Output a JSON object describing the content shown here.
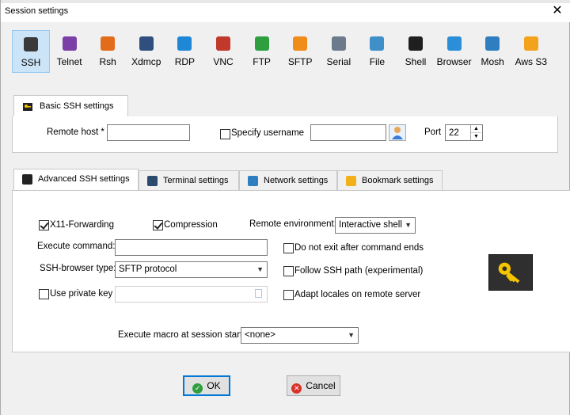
{
  "window": {
    "title": "Session settings",
    "close_glyph": "✕"
  },
  "session_types": [
    {
      "label": "SSH",
      "icon": "ssh-icon",
      "color": "#3a3a3a",
      "selected": true
    },
    {
      "label": "Telnet",
      "icon": "telnet-icon",
      "color": "#7b3fa8"
    },
    {
      "label": "Rsh",
      "icon": "rsh-icon",
      "color": "#e26c1a"
    },
    {
      "label": "Xdmcp",
      "icon": "xdmcp-icon",
      "color": "#2f4f7f"
    },
    {
      "label": "RDP",
      "icon": "rdp-icon",
      "color": "#1e88d6"
    },
    {
      "label": "VNC",
      "icon": "vnc-icon",
      "color": "#c0392b"
    },
    {
      "label": "FTP",
      "icon": "ftp-icon",
      "color": "#2e9e3e"
    },
    {
      "label": "SFTP",
      "icon": "sftp-icon",
      "color": "#f08c1a"
    },
    {
      "label": "Serial",
      "icon": "serial-icon",
      "color": "#6b7b8c"
    },
    {
      "label": "File",
      "icon": "file-icon",
      "color": "#3f8fc8"
    },
    {
      "label": "Shell",
      "icon": "shell-icon",
      "color": "#1f1f1f"
    },
    {
      "label": "Browser",
      "icon": "browser-icon",
      "color": "#2a8fd8"
    },
    {
      "label": "Mosh",
      "icon": "mosh-icon",
      "color": "#2f7fc0"
    },
    {
      "label": "Aws S3",
      "icon": "aws-s3-icon",
      "color": "#f2a31b"
    }
  ],
  "basic": {
    "tab_label": "Basic SSH settings",
    "remote_host_label": "Remote host *",
    "remote_host_value": "",
    "specify_username_label": "Specify username",
    "username_value": "",
    "port_label": "Port",
    "port_value": "22"
  },
  "tabs": [
    {
      "label": "Advanced SSH settings",
      "icon": "key-icon",
      "active": true
    },
    {
      "label": "Terminal settings",
      "icon": "terminal-icon"
    },
    {
      "label": "Network settings",
      "icon": "network-icon"
    },
    {
      "label": "Bookmark settings",
      "icon": "star-icon"
    }
  ],
  "advanced": {
    "x11_label": "X11-Forwarding",
    "x11_checked": true,
    "compression_label": "Compression",
    "compression_checked": true,
    "remote_env_label": "Remote environment:",
    "remote_env_value": "Interactive shell",
    "execute_command_label": "Execute command:",
    "execute_command_value": "",
    "do_not_exit_label": "Do not exit after command ends",
    "ssh_browser_label": "SSH-browser type:",
    "ssh_browser_value": "SFTP protocol",
    "follow_ssh_label": "Follow SSH path (experimental)",
    "use_private_key_label": "Use private key",
    "adapt_locales_label": "Adapt locales on remote server",
    "macro_label": "Execute macro at session start:",
    "macro_value": "<none>"
  },
  "buttons": {
    "ok": "OK",
    "cancel": "Cancel"
  }
}
